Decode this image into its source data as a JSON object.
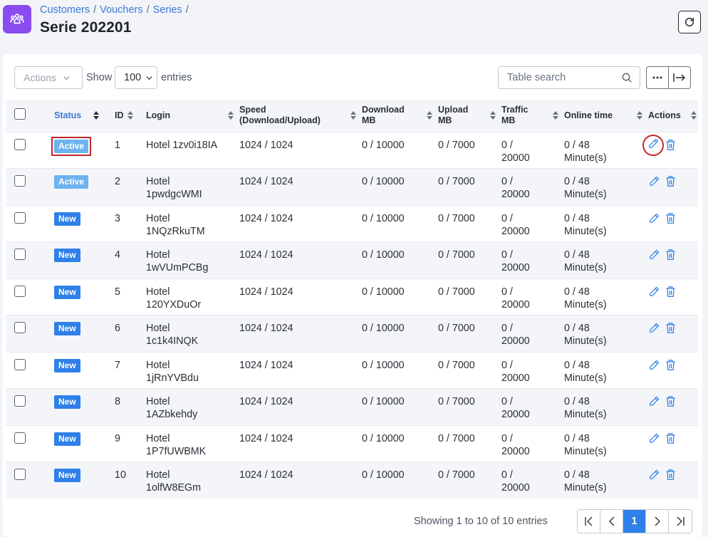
{
  "breadcrumb": [
    "Customers",
    "Vouchers",
    "Series"
  ],
  "page_title": "Serie 202201",
  "toolbar": {
    "actions_label": "Actions",
    "show_label": "Show",
    "page_length": "100",
    "entries_label": "entries",
    "search_placeholder": "Table search"
  },
  "table": {
    "columns": [
      {
        "label": "Status"
      },
      {
        "label": "ID"
      },
      {
        "label": "Login"
      },
      {
        "label": "Speed\n(Download/Upload)"
      },
      {
        "label": "Download\nMB"
      },
      {
        "label": "Upload\nMB"
      },
      {
        "label": "Traffic\nMB"
      },
      {
        "label": "Online time"
      },
      {
        "label": "Actions"
      }
    ],
    "rows": [
      {
        "status": "Active",
        "id": "1",
        "login": "Hotel 1zv0i18IA",
        "speed": "1024 / 1024",
        "download": "0 / 10000",
        "upload": "0 / 7000",
        "traffic": "0 / 20000",
        "online": "0 / 48 Minute(s)"
      },
      {
        "status": "Active",
        "id": "2",
        "login": "Hotel 1pwdgcWMI",
        "speed": "1024 / 1024",
        "download": "0 / 10000",
        "upload": "0 / 7000",
        "traffic": "0 / 20000",
        "online": "0 / 48 Minute(s)"
      },
      {
        "status": "New",
        "id": "3",
        "login": "Hotel 1NQzRkuTM",
        "speed": "1024 / 1024",
        "download": "0 / 10000",
        "upload": "0 / 7000",
        "traffic": "0 / 20000",
        "online": "0 / 48 Minute(s)"
      },
      {
        "status": "New",
        "id": "4",
        "login": "Hotel 1wVUmPCBg",
        "speed": "1024 / 1024",
        "download": "0 / 10000",
        "upload": "0 / 7000",
        "traffic": "0 / 20000",
        "online": "0 / 48 Minute(s)"
      },
      {
        "status": "New",
        "id": "5",
        "login": "Hotel 120YXDuOr",
        "speed": "1024 / 1024",
        "download": "0 / 10000",
        "upload": "0 / 7000",
        "traffic": "0 / 20000",
        "online": "0 / 48 Minute(s)"
      },
      {
        "status": "New",
        "id": "6",
        "login": "Hotel 1c1k4INQK",
        "speed": "1024 / 1024",
        "download": "0 / 10000",
        "upload": "0 / 7000",
        "traffic": "0 / 20000",
        "online": "0 / 48 Minute(s)"
      },
      {
        "status": "New",
        "id": "7",
        "login": "Hotel 1jRnYVBdu",
        "speed": "1024 / 1024",
        "download": "0 / 10000",
        "upload": "0 / 7000",
        "traffic": "0 / 20000",
        "online": "0 / 48 Minute(s)"
      },
      {
        "status": "New",
        "id": "8",
        "login": "Hotel 1AZbkehdy",
        "speed": "1024 / 1024",
        "download": "0 / 10000",
        "upload": "0 / 7000",
        "traffic": "0 / 20000",
        "online": "0 / 48 Minute(s)"
      },
      {
        "status": "New",
        "id": "9",
        "login": "Hotel 1P7fUWBMK",
        "speed": "1024 / 1024",
        "download": "0 / 10000",
        "upload": "0 / 7000",
        "traffic": "0 / 20000",
        "online": "0 / 48 Minute(s)"
      },
      {
        "status": "New",
        "id": "10",
        "login": "Hotel 1olfW8EGm",
        "speed": "1024 / 1024",
        "download": "0 / 10000",
        "upload": "0 / 7000",
        "traffic": "0 / 20000",
        "online": "0 / 48 Minute(s)"
      }
    ]
  },
  "footer": {
    "info": "Showing 1 to 10 of 10 entries",
    "current_page": "1"
  },
  "colors": {
    "accent": "#2f80e8",
    "active_badge": "#6cb3f0",
    "new_badge": "#2f80e8",
    "app_icon": "#8a4cf0",
    "highlight": "#c0282d"
  },
  "icons": {
    "app": "users-group-icon",
    "refresh": "refresh-icon",
    "search": "search-icon",
    "more": "more-dots-icon",
    "export": "export-arrow-icon",
    "edit": "pencil-icon",
    "delete": "trash-icon"
  }
}
